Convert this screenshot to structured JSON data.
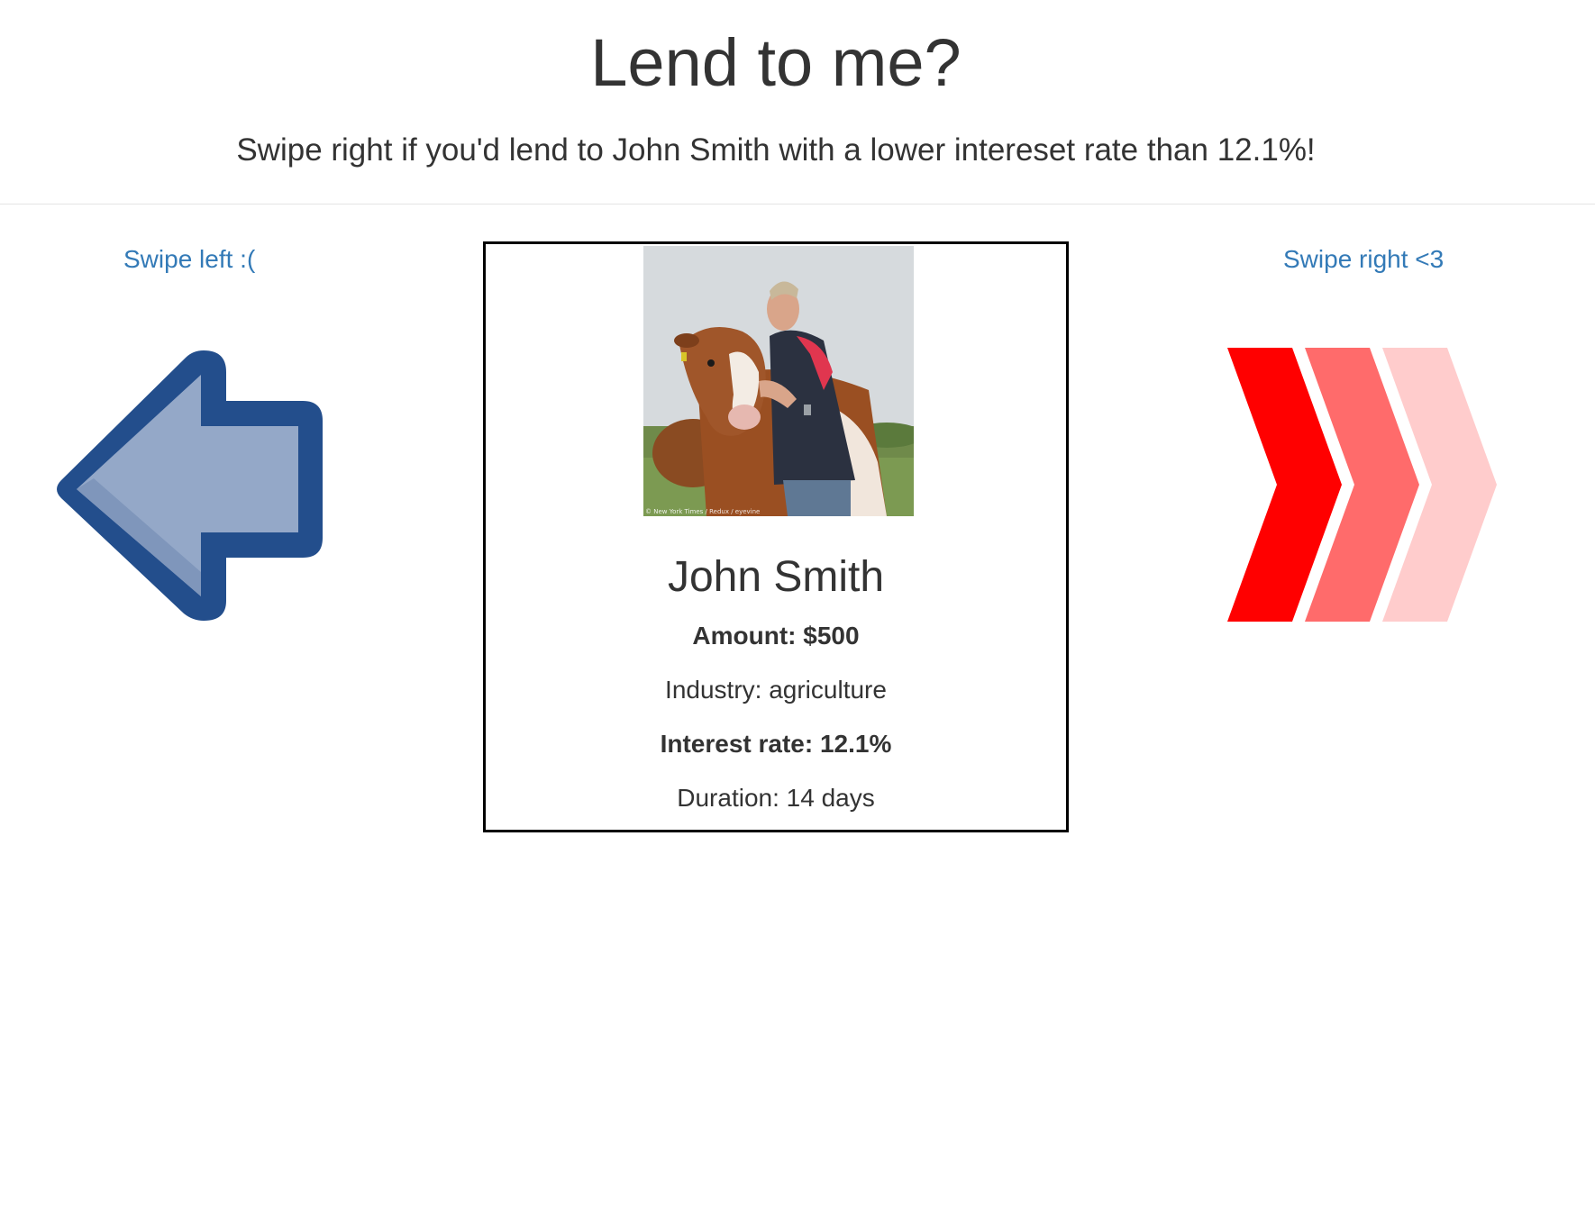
{
  "header": {
    "title": "Lend to me?",
    "subtitle": "Swipe right if you'd lend to John Smith with a lower intereset rate than 12.1%!"
  },
  "controls": {
    "swipe_left_label": "Swipe left :(",
    "swipe_right_label": "Swipe right <3",
    "left_icon": "left-arrow-icon",
    "right_icon": "triple-chevron-right-icon"
  },
  "borrower": {
    "photo_alt": "Man with cow",
    "photo_caption": "© New York Times / Redux / eyevine",
    "name": "John Smith",
    "amount": "Amount: $500",
    "industry": "Industry: agriculture",
    "interest_rate": "Interest rate: 12.1%",
    "duration": "Duration: 14 days"
  },
  "colors": {
    "link": "#337ab7",
    "arrow_dark": "#234e8c",
    "arrow_light": "#94a8c8",
    "chevron_1": "#ff0000",
    "chevron_2": "#ff6b6b",
    "chevron_3": "#ffcccc"
  }
}
